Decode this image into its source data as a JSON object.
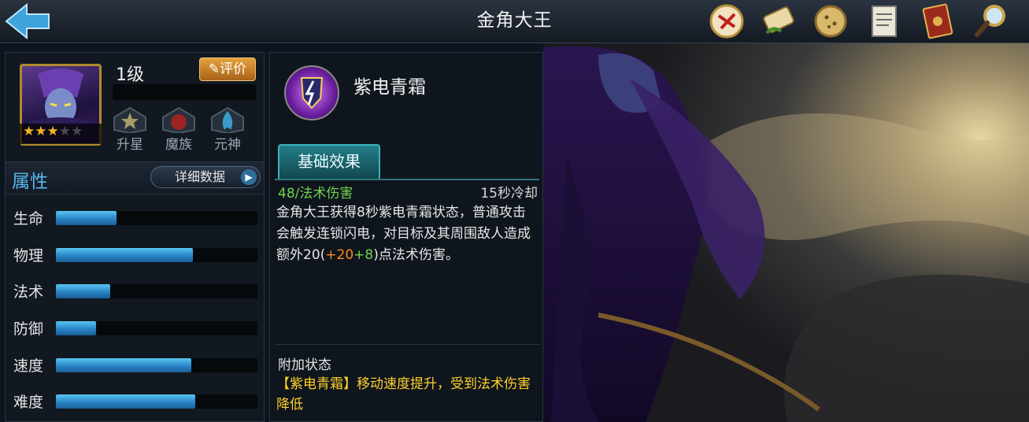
{
  "header": {
    "title": "金角大王",
    "icons": [
      "back-arrow-icon",
      "battle-seal-icon",
      "scroll-icon",
      "cookie-medal-icon",
      "document-icon",
      "book-icon",
      "magnifier-icon"
    ]
  },
  "hero": {
    "level": "1级",
    "rate_label": "评价",
    "stars_filled": 3,
    "stars_total": 5,
    "stars_text": "★★★",
    "stars_empty_text": "★★",
    "buttons": [
      {
        "label": "升星",
        "icon": "star-upgrade-icon"
      },
      {
        "label": "魔族",
        "icon": "demon-clan-icon"
      },
      {
        "label": "元神",
        "icon": "spirit-flame-icon"
      }
    ]
  },
  "attributes": {
    "title": "属性",
    "detail_label": "详细数据",
    "detail_arrow": "▶",
    "stats": [
      {
        "label": "生命",
        "value": 0.3
      },
      {
        "label": "物理",
        "value": 0.68
      },
      {
        "label": "法术",
        "value": 0.27
      },
      {
        "label": "防御",
        "value": 0.2
      },
      {
        "label": "速度",
        "value": 0.67
      },
      {
        "label": "难度",
        "value": 0.69
      }
    ]
  },
  "skill": {
    "name": "紫电青霜",
    "tab": "基础效果",
    "damage": "48/法术伤害",
    "cooldown": "15秒冷却",
    "desc_main": "金角大王获得8秒紫电青霜状态，普通攻击会触发连锁闪电，对目标及其周围敌人造成额外20(",
    "desc_plus_a": "+20",
    "desc_plus_b": "+8",
    "desc_tail": ")点法术伤害。",
    "extra_title": "附加状态",
    "extra_text": "【紫电青霜】移动速度提升，受到法术伤害降低"
  },
  "colors": {
    "accent_blue": "#5ab8ea",
    "damage_green": "#6fd44c",
    "bonus_orange": "#ff8a1c",
    "status_yellow": "#ffd02a"
  }
}
